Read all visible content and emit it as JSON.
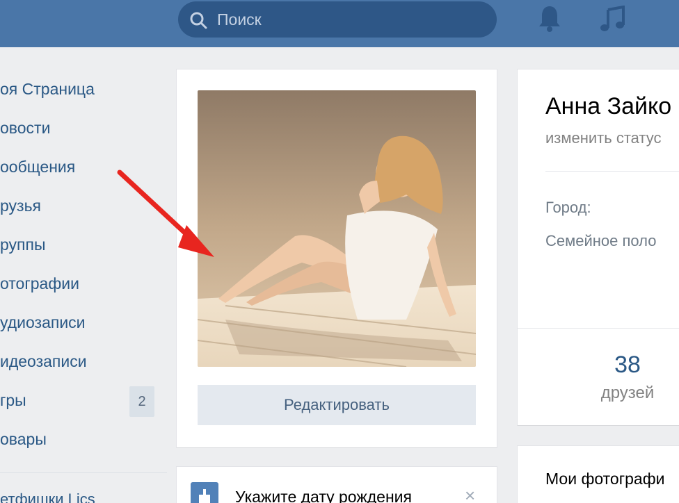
{
  "header": {
    "search_placeholder": "Поиск",
    "accent_color": "#4a76a8",
    "icons": [
      "search-icon",
      "bell-icon",
      "music-icon"
    ]
  },
  "menu": {
    "items": [
      {
        "label": "оя Страница"
      },
      {
        "label": "овости"
      },
      {
        "label": "ообщения"
      },
      {
        "label": "рузья"
      },
      {
        "label": "руппы"
      },
      {
        "label": "отографии"
      },
      {
        "label": "удиозаписи"
      },
      {
        "label": "идеозаписи"
      },
      {
        "label": "гры",
        "counter": "2"
      },
      {
        "label": "овары"
      }
    ],
    "footer": "етфишки Lics"
  },
  "avatar": {
    "edit_label": "Редактировать"
  },
  "birthday": {
    "text": "Укажите дату рождения",
    "close": "×"
  },
  "profile": {
    "name": "Анна Зайко",
    "status": "изменить статус",
    "city_label": "Город:",
    "family_label": "Семейное поло",
    "friends_count": "38",
    "friends_label": "друзей"
  },
  "photos": {
    "title": "Мои фотографи"
  }
}
